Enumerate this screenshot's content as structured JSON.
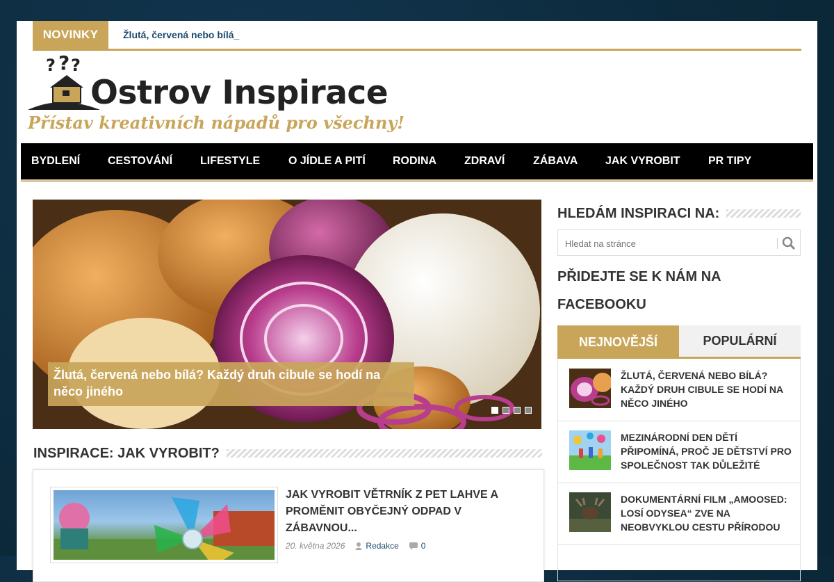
{
  "ticker": {
    "label": "NOVINKY",
    "headline": "Žlutá, červená nebo bílá_"
  },
  "logo": {
    "title": "Ostrov Inspirace",
    "tagline": "Přístav kreativních nápadů pro všechny!"
  },
  "nav": {
    "items": [
      "BYDLENÍ",
      "CESTOVÁNÍ",
      "LIFESTYLE",
      "O JÍDLE A PITÍ",
      "RODINA",
      "ZDRAVÍ",
      "ZÁBAVA",
      "JAK VYROBIT",
      "PR TIPY"
    ]
  },
  "slider": {
    "caption": "Žlutá, červená nebo bílá? Každý druh cibule se hodí na něco jiného",
    "slide_count": 4,
    "active_slide": 1
  },
  "section": {
    "heading": "INSPIRACE: JAK VYROBIT?"
  },
  "article": {
    "title": "JAK VYROBIT VĚTRNÍK Z PET LAHVE A PROMĚNIT OBYČEJNÝ ODPAD V ZÁBAVNOU...",
    "date": "20. května 2026",
    "author": "Redakce",
    "comments": "0"
  },
  "sidebar": {
    "search_heading": "HLEDÁM INSPIRACI NA:",
    "search_placeholder": "Hledat na stránce",
    "facebook_heading": "PŘIDEJTE SE K NÁM NA FACEBOOKU",
    "tabs": [
      "NEJNOVĚJŠÍ",
      "POPULÁRNÍ"
    ],
    "posts": [
      {
        "title": "ŽLUTÁ, ČERVENÁ NEBO BÍLÁ? KAŽDÝ DRUH CIBULE SE HODÍ NA NĚCO JINÉHO",
        "thumb": "onions"
      },
      {
        "title": "MEZINÁRODNÍ DEN DĚTÍ PŘIPOMÍNÁ, PROČ JE DĚTSTVÍ PRO SPOLEČNOST TAK DŮLEŽITÉ",
        "thumb": "children"
      },
      {
        "title": "DOKUMENTÁRNÍ FILM „AMOOSED: LOSÍ ODYSEA“ ZVE NA NEOBVYKLOU CESTU PŘÍRODOU",
        "thumb": "moose"
      }
    ]
  },
  "colors": {
    "accent": "#c9a55a",
    "nav_bg": "#000000",
    "link": "#1c4a6e",
    "body_bg": "#0d2b3f"
  }
}
